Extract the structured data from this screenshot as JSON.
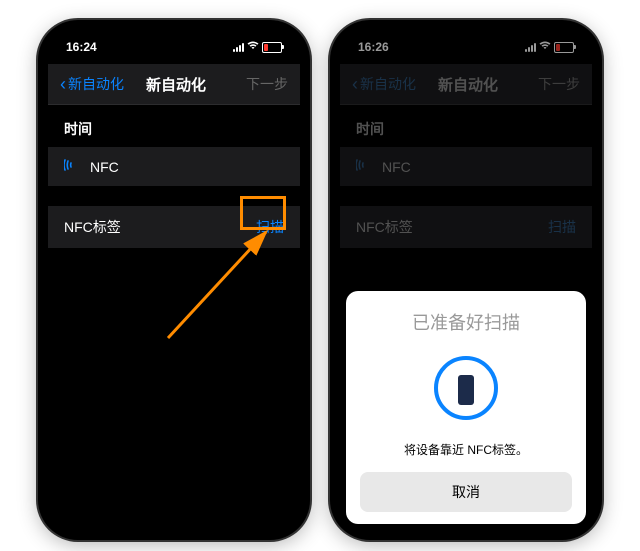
{
  "left": {
    "status_time": "16:24",
    "nav_back": "新自动化",
    "nav_title": "新自动化",
    "nav_next": "下一步",
    "section_time": "时间",
    "nfc_label": "NFC",
    "nfc_tag_label": "NFC标签",
    "scan_action": "扫描"
  },
  "right": {
    "status_time": "16:26",
    "nav_back": "新自动化",
    "nav_title": "新自动化",
    "nav_next": "下一步",
    "section_time": "时间",
    "nfc_label": "NFC",
    "nfc_tag_label": "NFC标签",
    "scan_action": "扫描",
    "sheet_title": "已准备好扫描",
    "sheet_message": "将设备靠近 NFC标签。",
    "cancel": "取消"
  },
  "colors": {
    "ios_blue": "#0a84ff",
    "highlight": "#ff8c00"
  }
}
